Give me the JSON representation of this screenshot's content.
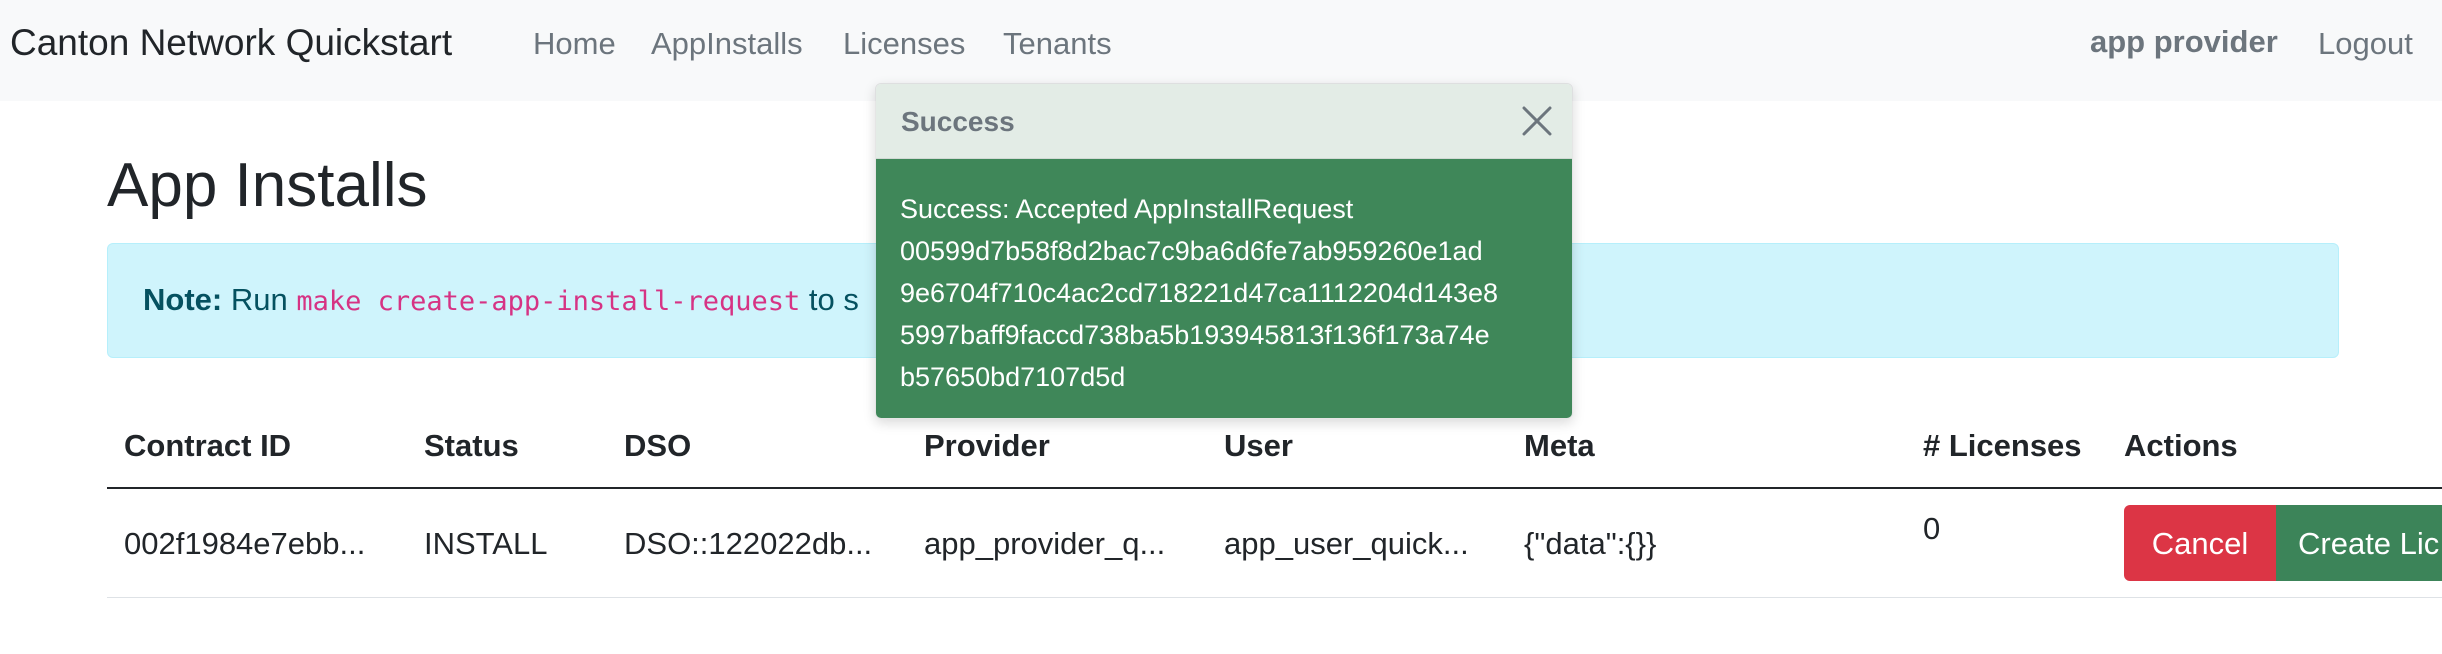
{
  "navbar": {
    "brand": "Canton Network Quickstart",
    "links": [
      "Home",
      "AppInstalls",
      "Licenses",
      "Tenants"
    ],
    "user": "app provider",
    "logout": "Logout"
  },
  "page": {
    "title": "App Installs"
  },
  "note": {
    "label": "Note:",
    "prefix": " Run ",
    "command": "make create-app-install-request",
    "suffix": " to s"
  },
  "table": {
    "headers": [
      "Contract ID",
      "Status",
      "DSO",
      "Provider",
      "User",
      "Meta",
      "# Licenses",
      "Actions"
    ],
    "rows": [
      {
        "contract_id": "002f1984e7ebb...",
        "status": "INSTALL",
        "dso": "DSO::122022db...",
        "provider": "app_provider_q...",
        "user": "app_user_quick...",
        "meta": "{\"data\":{}}",
        "licenses": "0",
        "cancel_label": "Cancel",
        "create_label": "Create Lic"
      }
    ]
  },
  "toast": {
    "title": "Success",
    "lines": [
      "Success: Accepted AppInstallRequest",
      "00599d7b58f8d2bac7c9ba6d6fe7ab959260e1ad",
      "9e6704f710c4ac2cd718221d47ca1112204d143e8",
      "5997baff9faccd738ba5b193945813f136f173a74e",
      "b57650bd7107d5d"
    ],
    "close_icon": "close-icon"
  },
  "colors": {
    "success": "#3f8759",
    "danger": "#dc3545",
    "info_bg": "#cff4fc"
  }
}
